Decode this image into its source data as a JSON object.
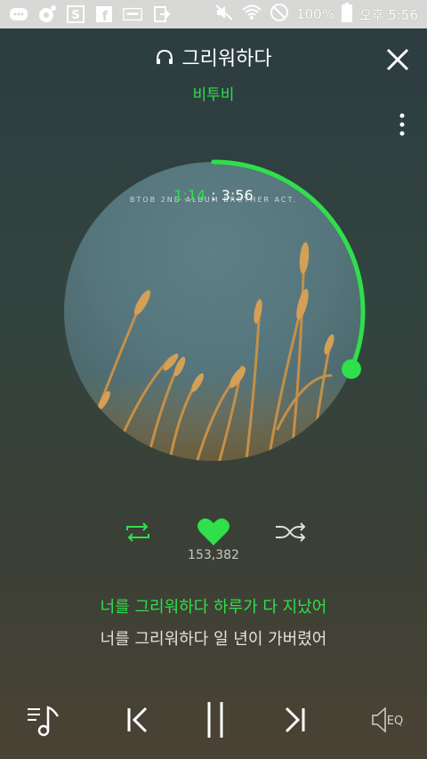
{
  "status_bar": {
    "battery_percent": "100%",
    "time": "오후 5:56"
  },
  "track": {
    "title": "그리워하다",
    "artist": "비투비",
    "album_caption": "BTOB 2ND ALBUM   BROTHER ACT.",
    "current_time": "1:14",
    "separator": ":",
    "total_time": "3:56",
    "progress": 0.313
  },
  "actions": {
    "like_count": "153,382"
  },
  "lyrics": {
    "current": "너를 그리워하다 하루가 다 지났어",
    "next": "너를 그리워하다 일 년이 가버렸어"
  },
  "colors": {
    "accent": "#2ee04a",
    "status_bar": "#d8d9d6"
  },
  "icons": {
    "repeat": "repeat-icon",
    "like": "heart-icon",
    "shuffle": "shuffle-icon",
    "playlist": "playlist-icon",
    "previous": "previous-icon",
    "pause": "pause-icon",
    "next": "next-icon",
    "eq": "eq-icon"
  }
}
